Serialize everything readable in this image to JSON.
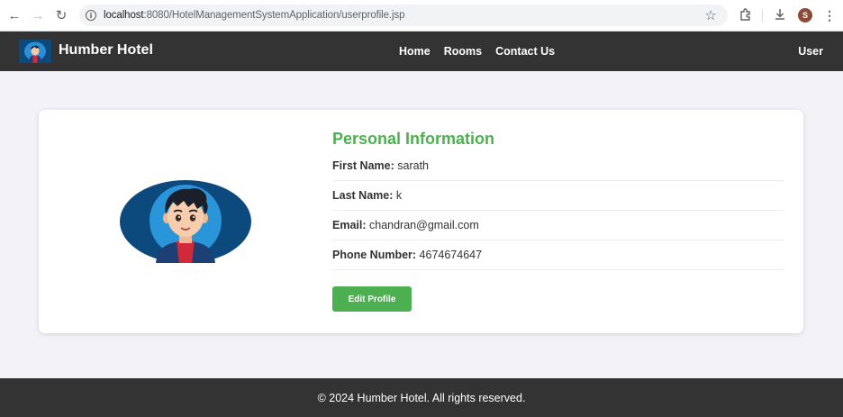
{
  "browser": {
    "url_host": "localhost",
    "url_path": ":8080/HotelManagementSystemApplication/userprofile.jsp",
    "profile_initial": "S"
  },
  "navbar": {
    "brand": "Humber Hotel",
    "links": [
      "Home",
      "Rooms",
      "Contact Us"
    ],
    "user": "User"
  },
  "profile": {
    "title": "Personal Information",
    "fields": [
      {
        "label": "First Name:",
        "value": "sarath"
      },
      {
        "label": "Last Name:",
        "value": "k"
      },
      {
        "label": "Email:",
        "value": "chandran@gmail.com"
      },
      {
        "label": "Phone Number:",
        "value": "4674674647"
      }
    ],
    "edit_button": "Edit Profile"
  },
  "footer": {
    "text": "© 2024 Humber Hotel. All rights reserved."
  },
  "colors": {
    "accent": "#4caf50",
    "navbar": "#333333",
    "page_bg": "#f2f2f7",
    "avatar_bg": "#0c4a7d"
  }
}
